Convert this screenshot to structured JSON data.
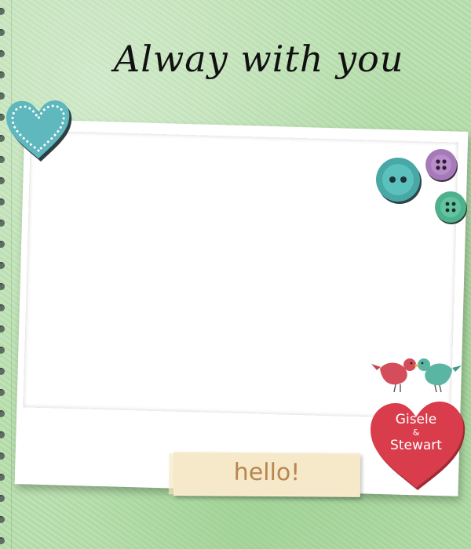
{
  "title": "Alway with you",
  "tag": {
    "label": "hello!"
  },
  "heart_label": {
    "name1": "Gisele",
    "amp": "&",
    "name2": "Stewart"
  },
  "colors": {
    "background": "#b9e0ae",
    "teal_heart": "#5fb8bd",
    "red_heart": "#d93d4c",
    "tag": "#f6ecd0",
    "tag_text": "#b8854e"
  },
  "icons": [
    "teal-heart-icon",
    "teal-button-icon",
    "purple-button-icon",
    "green-button-icon",
    "love-birds-icon",
    "red-heart-icon"
  ]
}
